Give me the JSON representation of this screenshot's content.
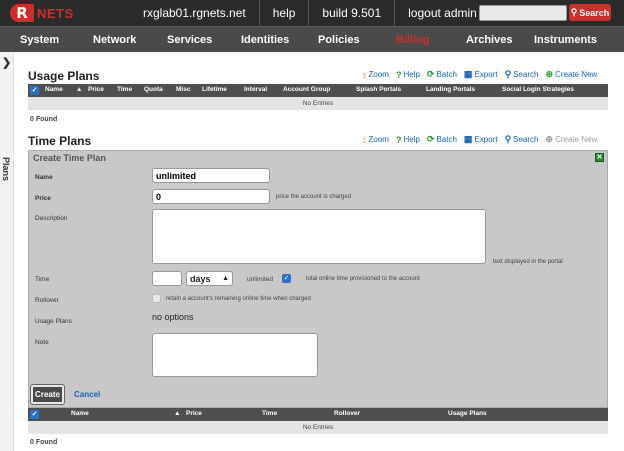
{
  "brand": {
    "logo_letter": "R",
    "name": "NETS"
  },
  "topbar": {
    "items": [
      "rxglab01.rgnets.net",
      "help",
      "build 9.501",
      "logout admin"
    ],
    "search_value": "",
    "search_button": "Search"
  },
  "mainnav": {
    "items": [
      "System",
      "Network",
      "Services",
      "Identities",
      "Policies",
      "Billing",
      "Archives",
      "Instruments"
    ],
    "active": "Billing"
  },
  "sidebar": {
    "label": "Plans",
    "toggle": "❯"
  },
  "usage_plans": {
    "title": "Usage Plans",
    "actions": [
      {
        "label": "Zoom",
        "icon": "zoom-icon"
      },
      {
        "label": "Help",
        "icon": "help-icon"
      },
      {
        "label": "Batch",
        "icon": "batch-icon"
      },
      {
        "label": "Export",
        "icon": "export-icon"
      },
      {
        "label": "Search",
        "icon": "search-icon"
      },
      {
        "label": "Create New",
        "icon": "create-new-icon"
      }
    ],
    "columns": [
      "Name",
      "Price",
      "Time",
      "Quota",
      "Misc",
      "Lifetime",
      "Interval",
      "Account Group",
      "Splash Portals",
      "Landing Portals",
      "Social Login Strategies"
    ],
    "empty": "No Entries",
    "found": "0 Found"
  },
  "time_plans": {
    "title": "Time Plans",
    "actions": [
      {
        "label": "Zoom",
        "icon": "zoom-icon"
      },
      {
        "label": "Help",
        "icon": "help-icon"
      },
      {
        "label": "Batch",
        "icon": "batch-icon"
      },
      {
        "label": "Export",
        "icon": "export-icon"
      },
      {
        "label": "Search",
        "icon": "search-icon"
      },
      {
        "label": "Create New",
        "icon": "create-new-icon"
      }
    ],
    "columns": [
      "Name",
      "Price",
      "Time",
      "Rollover",
      "Usage Plans"
    ],
    "empty": "No Entries",
    "found": "0 Found"
  },
  "form": {
    "title": "Create Time Plan",
    "name_label": "Name",
    "name_value": "unlimited",
    "price_label": "Price",
    "price_value": "0",
    "price_hint": "price the account is charged",
    "description_label": "Description",
    "description_value": "",
    "description_hint": "text displayed in the portal",
    "time_label": "Time",
    "time_value": "",
    "time_unit": "days",
    "unlimited_label": "unlimited",
    "unlimited_checked": true,
    "time_hint": "total online time provisioned to the account",
    "rollover_label": "Rollover",
    "rollover_checked": false,
    "rollover_hint": "retain a account's remaining online time when charged",
    "usage_plans_label": "Usage Plans",
    "usage_plans_value": "no options",
    "note_label": "Note",
    "note_value": "",
    "create_button": "Create",
    "cancel_link": "Cancel"
  }
}
